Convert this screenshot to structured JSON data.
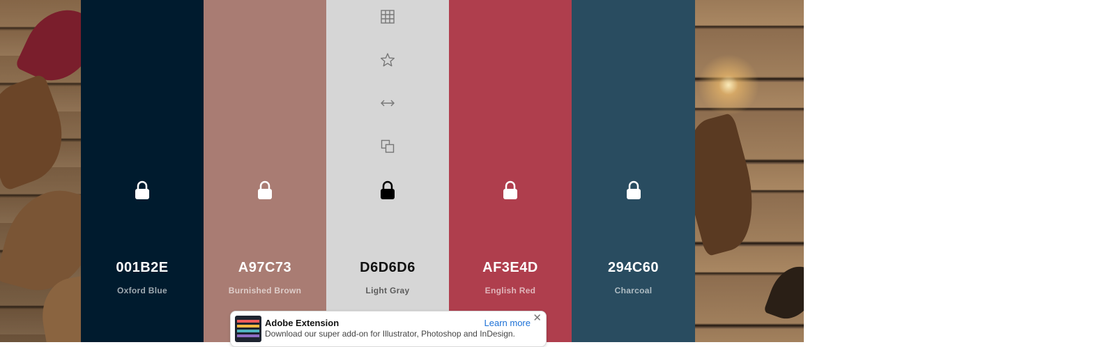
{
  "colors": [
    {
      "hex": "001B2E",
      "name": "Oxford Blue",
      "bg": "#001B2E",
      "fg": "#ffffff",
      "locked": false
    },
    {
      "hex": "A97C73",
      "name": "Burnished Brown",
      "bg": "#A97C73",
      "fg": "#ffffff",
      "locked": false
    },
    {
      "hex": "D6D6D6",
      "name": "Light Gray",
      "bg": "#D6D6D6",
      "fg": "#111111",
      "locked": false
    },
    {
      "hex": "AF3E4D",
      "name": "English Red",
      "bg": "#AF3E4D",
      "fg": "#ffffff",
      "locked": false
    },
    {
      "hex": "294C60",
      "name": "Charcoal",
      "bg": "#294C60",
      "fg": "#ffffff",
      "locked": false
    }
  ],
  "hovered_tools": [
    "view-shades-icon",
    "save-color-icon",
    "drag-icon",
    "copy-hex-icon"
  ],
  "ad": {
    "title": "Adobe Extension",
    "description": "Download our super add-on for Illustrator, Photoshop and InDesign.",
    "link_label": "Learn more",
    "close_glyph": "✕"
  }
}
